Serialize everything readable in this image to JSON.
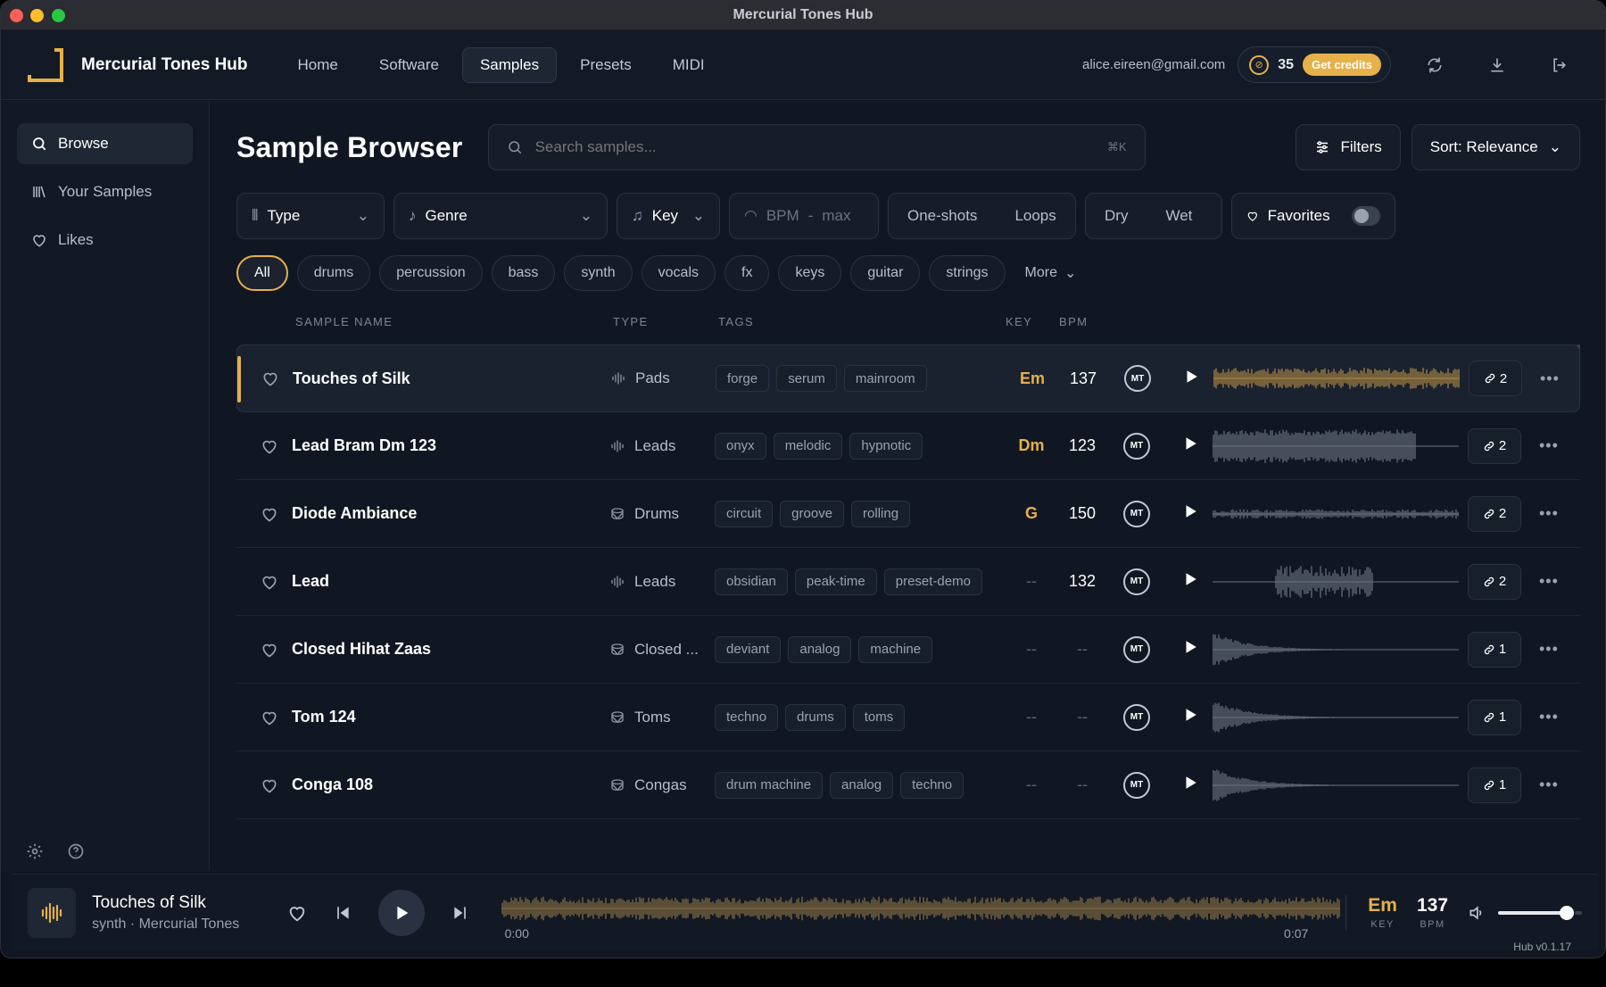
{
  "window": {
    "title": "Mercurial Tones Hub"
  },
  "header": {
    "brand": "Mercurial Tones Hub",
    "nav": [
      {
        "label": "Home"
      },
      {
        "label": "Software"
      },
      {
        "label": "Samples",
        "active": true
      },
      {
        "label": "Presets"
      },
      {
        "label": "MIDI"
      }
    ],
    "email": "alice.eireen@gmail.com",
    "credits": "35",
    "get_credits": "Get credits"
  },
  "sidebar": {
    "items": [
      {
        "label": "Browse",
        "icon": "search-icon",
        "active": true
      },
      {
        "label": "Your Samples",
        "icon": "library-icon"
      },
      {
        "label": "Likes",
        "icon": "heart-icon"
      }
    ]
  },
  "main": {
    "title": "Sample Browser",
    "search_placeholder": "Search samples...",
    "search_shortcut": "⌘K",
    "filters_label": "Filters",
    "sort_label": "Sort: Relevance",
    "filters": {
      "type": "Type",
      "genre": "Genre",
      "key": "Key",
      "bpm": "BPM",
      "bpm_sep": "-",
      "bpm_max": "max",
      "oneshots": "One-shots",
      "loops": "Loops",
      "dry": "Dry",
      "wet": "Wet",
      "favorites": "Favorites"
    },
    "chips": [
      "All",
      "drums",
      "percussion",
      "bass",
      "synth",
      "vocals",
      "fx",
      "keys",
      "guitar",
      "strings"
    ],
    "more": "More",
    "columns": {
      "name": "SAMPLE NAME",
      "type": "TYPE",
      "tags": "TAGS",
      "key": "KEY",
      "bpm": "BPM"
    },
    "rows": [
      {
        "name": "Touches of Silk",
        "type": "Pads",
        "type_icon": "waveform-icon",
        "tags": [
          "forge",
          "serum",
          "mainroom"
        ],
        "key": "Em",
        "bpm": "137",
        "count": "2",
        "wave_color": "#b08a45",
        "wave_shape": "full"
      },
      {
        "name": "Lead Bram Dm 123",
        "type": "Leads",
        "type_icon": "waveform-icon",
        "tags": [
          "onyx",
          "melodic",
          "hypnotic"
        ],
        "key": "Dm",
        "bpm": "123",
        "count": "2",
        "wave_color": "#6b7280",
        "wave_shape": "dense"
      },
      {
        "name": "Diode Ambiance",
        "type": "Drums",
        "type_icon": "drum-icon",
        "tags": [
          "circuit",
          "groove",
          "rolling"
        ],
        "key": "G",
        "bpm": "150",
        "count": "2",
        "wave_color": "#6b7280",
        "wave_shape": "thin"
      },
      {
        "name": "Lead",
        "type": "Leads",
        "type_icon": "waveform-icon",
        "tags": [
          "obsidian",
          "peak-time",
          "preset-demo"
        ],
        "key": "--",
        "bpm": "132",
        "count": "2",
        "wave_color": "#6b7280",
        "wave_shape": "middle"
      },
      {
        "name": "Closed Hihat Zaas",
        "type": "Closed ...",
        "type_icon": "drum-icon",
        "tags": [
          "deviant",
          "analog",
          "machine"
        ],
        "key": "--",
        "bpm": "--",
        "count": "1",
        "wave_color": "#6b7280",
        "wave_shape": "decay"
      },
      {
        "name": "Tom 124",
        "type": "Toms",
        "type_icon": "drum-icon",
        "tags": [
          "techno",
          "drums",
          "toms"
        ],
        "key": "--",
        "bpm": "--",
        "count": "1",
        "wave_color": "#6b7280",
        "wave_shape": "decay"
      },
      {
        "name": "Conga 108",
        "type": "Congas",
        "type_icon": "drum-icon",
        "tags": [
          "drum machine",
          "analog",
          "techno"
        ],
        "key": "--",
        "bpm": "--",
        "count": "1",
        "wave_color": "#6b7280",
        "wave_shape": "decay"
      }
    ],
    "mt_label": "MT"
  },
  "player": {
    "title": "Touches of Silk",
    "subtitle": "synth · Mercurial Tones",
    "time_start": "0:00",
    "time_end": "0:07",
    "key": "Em",
    "key_label": "KEY",
    "bpm": "137",
    "bpm_label": "BPM",
    "volume": 0.9
  },
  "version": "Hub v0.1.17",
  "colors": {
    "accent": "#e6b04a",
    "background": "#111722"
  }
}
